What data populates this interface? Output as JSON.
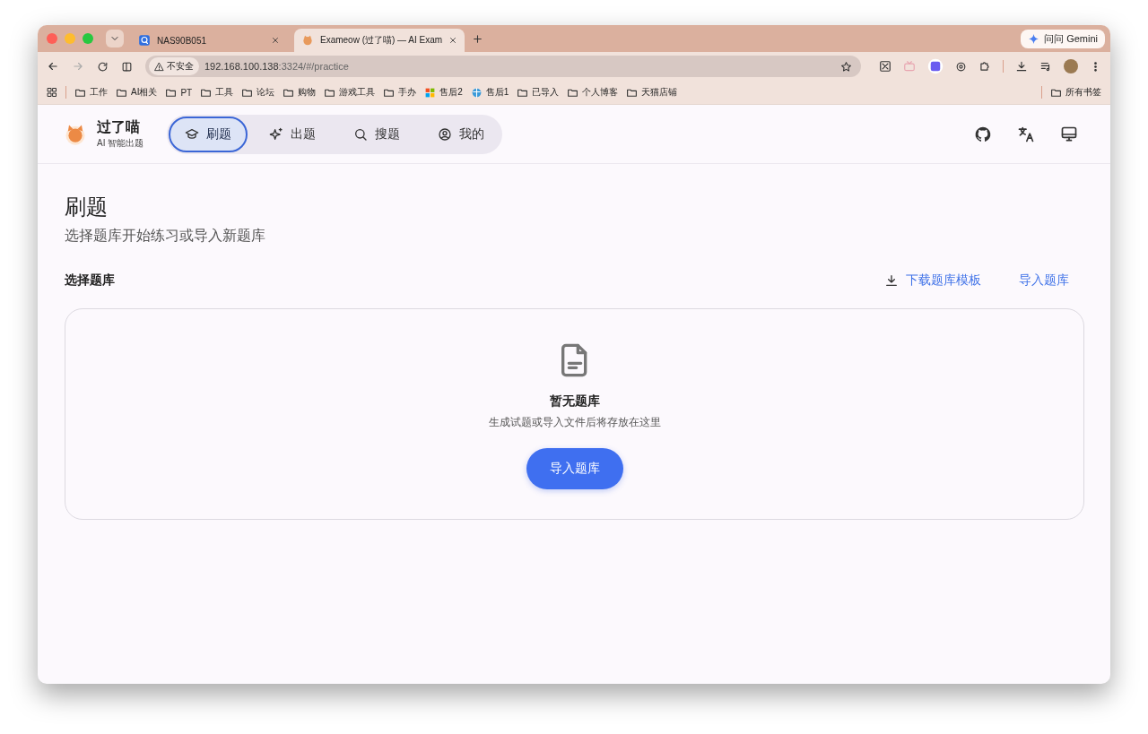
{
  "browser": {
    "tabs": [
      {
        "title": "NAS90B051",
        "selected": false,
        "kind": "nas"
      },
      {
        "title": "Exameow (过了喵) — AI Exam",
        "selected": true,
        "kind": "cat"
      }
    ],
    "gemini_button": "问问 Gemini",
    "security_label": "不安全",
    "url_host": "192.168.100.138",
    "url_rest": ":3324/#/practice",
    "bookmarks": [
      {
        "label": "工作",
        "kind": "folder"
      },
      {
        "label": "AI相关",
        "kind": "folder"
      },
      {
        "label": "PT",
        "kind": "folder"
      },
      {
        "label": "工具",
        "kind": "folder"
      },
      {
        "label": "论坛",
        "kind": "folder"
      },
      {
        "label": "购物",
        "kind": "folder"
      },
      {
        "label": "游戏工具",
        "kind": "folder"
      },
      {
        "label": "手办",
        "kind": "folder"
      },
      {
        "label": "售后2",
        "kind": "tiles"
      },
      {
        "label": "售后1",
        "kind": "globe"
      },
      {
        "label": "已导入",
        "kind": "folder"
      },
      {
        "label": "个人博客",
        "kind": "folder"
      },
      {
        "label": "天猫店铺",
        "kind": "folder"
      }
    ],
    "all_bookmarks": "所有书签"
  },
  "app": {
    "brand": "过了喵",
    "tagline": "AI 智能出题",
    "nav": [
      {
        "label": "刷题",
        "kind": "cap",
        "selected": true
      },
      {
        "label": "出题",
        "kind": "sparkle",
        "selected": false
      },
      {
        "label": "搜题",
        "kind": "search",
        "selected": false
      },
      {
        "label": "我的",
        "kind": "user",
        "selected": false
      }
    ],
    "title": "刷题",
    "subtitle": "选择题库开始练习或导入新题库",
    "section_label": "选择题库",
    "download_link": "下载题库模板",
    "import_link": "导入题库",
    "empty": {
      "title": "暂无题库",
      "text": "生成试题或导入文件后将存放在这里",
      "button": "导入题库"
    }
  }
}
